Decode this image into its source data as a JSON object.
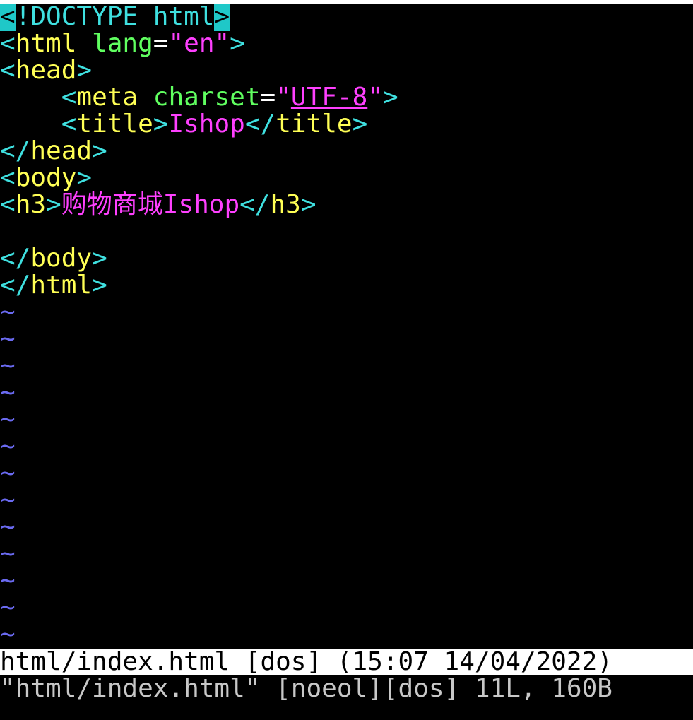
{
  "editor": {
    "lines": [
      {
        "segments": [
          {
            "t": "<",
            "c": "cursor-cell"
          },
          {
            "t": "!DOCTYPE html",
            "c": "doctype"
          },
          {
            "t": ">",
            "c": "cursor-cell"
          }
        ]
      },
      {
        "segments": [
          {
            "t": "<",
            "c": "bracket"
          },
          {
            "t": "html",
            "c": "tagname"
          },
          {
            "t": " ",
            "c": "punct"
          },
          {
            "t": "lang",
            "c": "attr"
          },
          {
            "t": "=",
            "c": "punct"
          },
          {
            "t": "\"en\"",
            "c": "string"
          },
          {
            "t": ">",
            "c": "bracket"
          }
        ]
      },
      {
        "segments": [
          {
            "t": "<",
            "c": "bracket"
          },
          {
            "t": "head",
            "c": "tagname"
          },
          {
            "t": ">",
            "c": "bracket"
          }
        ]
      },
      {
        "segments": [
          {
            "t": "    ",
            "c": "punct"
          },
          {
            "t": "<",
            "c": "bracket"
          },
          {
            "t": "meta",
            "c": "tagname"
          },
          {
            "t": " ",
            "c": "punct"
          },
          {
            "t": "charset",
            "c": "attr"
          },
          {
            "t": "=",
            "c": "punct"
          },
          {
            "t": "\"",
            "c": "string"
          },
          {
            "t": "UTF-8",
            "c": "string-underline"
          },
          {
            "t": "\"",
            "c": "string"
          },
          {
            "t": ">",
            "c": "bracket"
          }
        ]
      },
      {
        "segments": [
          {
            "t": "    ",
            "c": "punct"
          },
          {
            "t": "<",
            "c": "bracket"
          },
          {
            "t": "title",
            "c": "tagname"
          },
          {
            "t": ">",
            "c": "bracket"
          },
          {
            "t": "Ishop",
            "c": "text"
          },
          {
            "t": "</",
            "c": "bracket"
          },
          {
            "t": "title",
            "c": "tagname"
          },
          {
            "t": ">",
            "c": "bracket"
          }
        ]
      },
      {
        "segments": [
          {
            "t": "</",
            "c": "bracket"
          },
          {
            "t": "head",
            "c": "tagname"
          },
          {
            "t": ">",
            "c": "bracket"
          }
        ]
      },
      {
        "segments": [
          {
            "t": "<",
            "c": "bracket"
          },
          {
            "t": "body",
            "c": "tagname"
          },
          {
            "t": ">",
            "c": "bracket"
          }
        ]
      },
      {
        "segments": [
          {
            "t": "<",
            "c": "bracket"
          },
          {
            "t": "h3",
            "c": "tagname"
          },
          {
            "t": ">",
            "c": "bracket"
          },
          {
            "t": "购物商城",
            "c": "cjk"
          },
          {
            "t": "Ishop",
            "c": "text"
          },
          {
            "t": "</",
            "c": "bracket"
          },
          {
            "t": "h3",
            "c": "tagname"
          },
          {
            "t": ">",
            "c": "bracket"
          }
        ]
      },
      {
        "segments": []
      },
      {
        "segments": [
          {
            "t": "</",
            "c": "bracket"
          },
          {
            "t": "body",
            "c": "tagname"
          },
          {
            "t": ">",
            "c": "bracket"
          }
        ]
      },
      {
        "segments": [
          {
            "t": "</",
            "c": "bracket"
          },
          {
            "t": "html",
            "c": "tagname"
          },
          {
            "t": ">",
            "c": "bracket"
          }
        ]
      }
    ],
    "empty_marker": "~",
    "empty_marker_count": 13
  },
  "statusline": "html/index.html [dos] (15:07 14/04/2022)",
  "cmdline": "\"html/index.html\" [noeol][dos] 11L, 160B",
  "colors": {
    "background": "#000000",
    "tag_bracket": "#3fe0e0",
    "tag_name": "#ffff55",
    "attribute": "#60ff60",
    "string": "#ff40ff",
    "empty_marker": "#6a6af0",
    "cursor": "#1fc8c8",
    "statusline_bg": "#ffffff"
  }
}
